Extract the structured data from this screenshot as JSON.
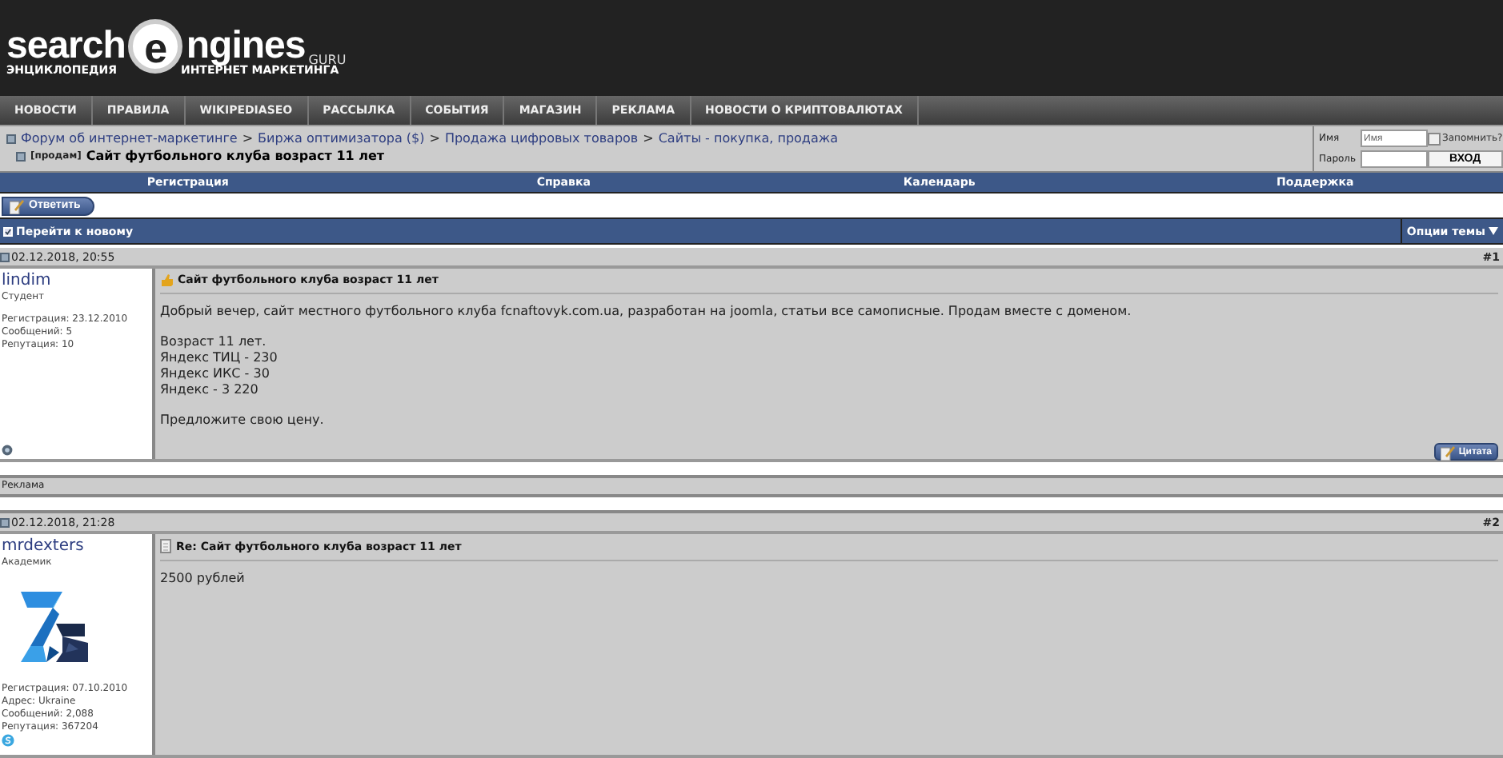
{
  "logo": {
    "left": "search",
    "letter": "e",
    "right": "ngines",
    "domain": "GURU",
    "tagline_left": "ЭНЦИКЛОПЕДИЯ",
    "tagline_right": "ИНТЕРНЕТ МАРКЕТИНГА"
  },
  "nav": [
    "НОВОСТИ",
    "ПРАВИЛА",
    "WIKIPEDIASEO",
    "РАССЫЛКА",
    "СОБЫТИЯ",
    "МАГАЗИН",
    "РЕКЛАМА",
    "НОВОСТИ О КРИПТОВАЛЮТАХ"
  ],
  "breadcrumb": {
    "separator": ">",
    "links": [
      "Форум об интернет-маркетинге",
      "Биржа оптимизатора ($)",
      "Продажа цифровых товаров",
      "Сайты - покупка, продажа"
    ],
    "prefix": "[продам]",
    "title": "Сайт футбольного клуба возраст 11 лет"
  },
  "login": {
    "name_label": "Имя",
    "name_value": "Имя",
    "remember_label": "Запомнить?",
    "remember_checked": false,
    "password_label": "Пароль",
    "button": "ВХОД"
  },
  "menu": [
    "Регистрация",
    "Справка",
    "Календарь",
    "Поддержка"
  ],
  "reply_button": "Ответить",
  "thread_bar": {
    "goto_new": "Перейти к новому",
    "options": "Опции темы"
  },
  "posts": [
    {
      "date": "02.12.2018, 20:55",
      "number": "#1",
      "author": "lindim",
      "rank": "Студент",
      "avatar": false,
      "info": [
        "Регистрация: 23.12.2010",
        "Сообщений: 5",
        "Репутация: 10"
      ],
      "contact_icon": {
        "kind": "status"
      },
      "title_icon": {
        "kind": "thumb"
      },
      "title": "Сайт футбольного клуба возраст 11 лет",
      "paragraphs": [
        [
          "Добрый вечер, сайт местного футбольного клуба fcnaftovyk.com.ua, разработан на joomla, статьи все самописные. Продам вместе с доменом."
        ],
        [
          "Возраст 11 лет.",
          "Яндекс ТИЦ - 230",
          "Яндекс ИКС - 30",
          "Яндекс - 3 220"
        ],
        [
          "Предложите свою цену."
        ]
      ],
      "quote_button": "Цитата"
    },
    {
      "date": "02.12.2018, 21:28",
      "number": "#2",
      "author": "mrdexters",
      "rank": "Академик",
      "avatar": true,
      "info": [
        "Регистрация: 07.10.2010",
        "Адрес: Ukraine",
        "Сообщений: 2,088",
        "Репутация: 367204"
      ],
      "contact_icon": {
        "kind": "skype"
      },
      "title_icon": {
        "kind": "document"
      },
      "title": "Re: Сайт футбольного клуба возраст 11 лет",
      "paragraphs": [
        [
          "2500 рублей"
        ]
      ]
    }
  ],
  "ad_label": "Реклама"
}
